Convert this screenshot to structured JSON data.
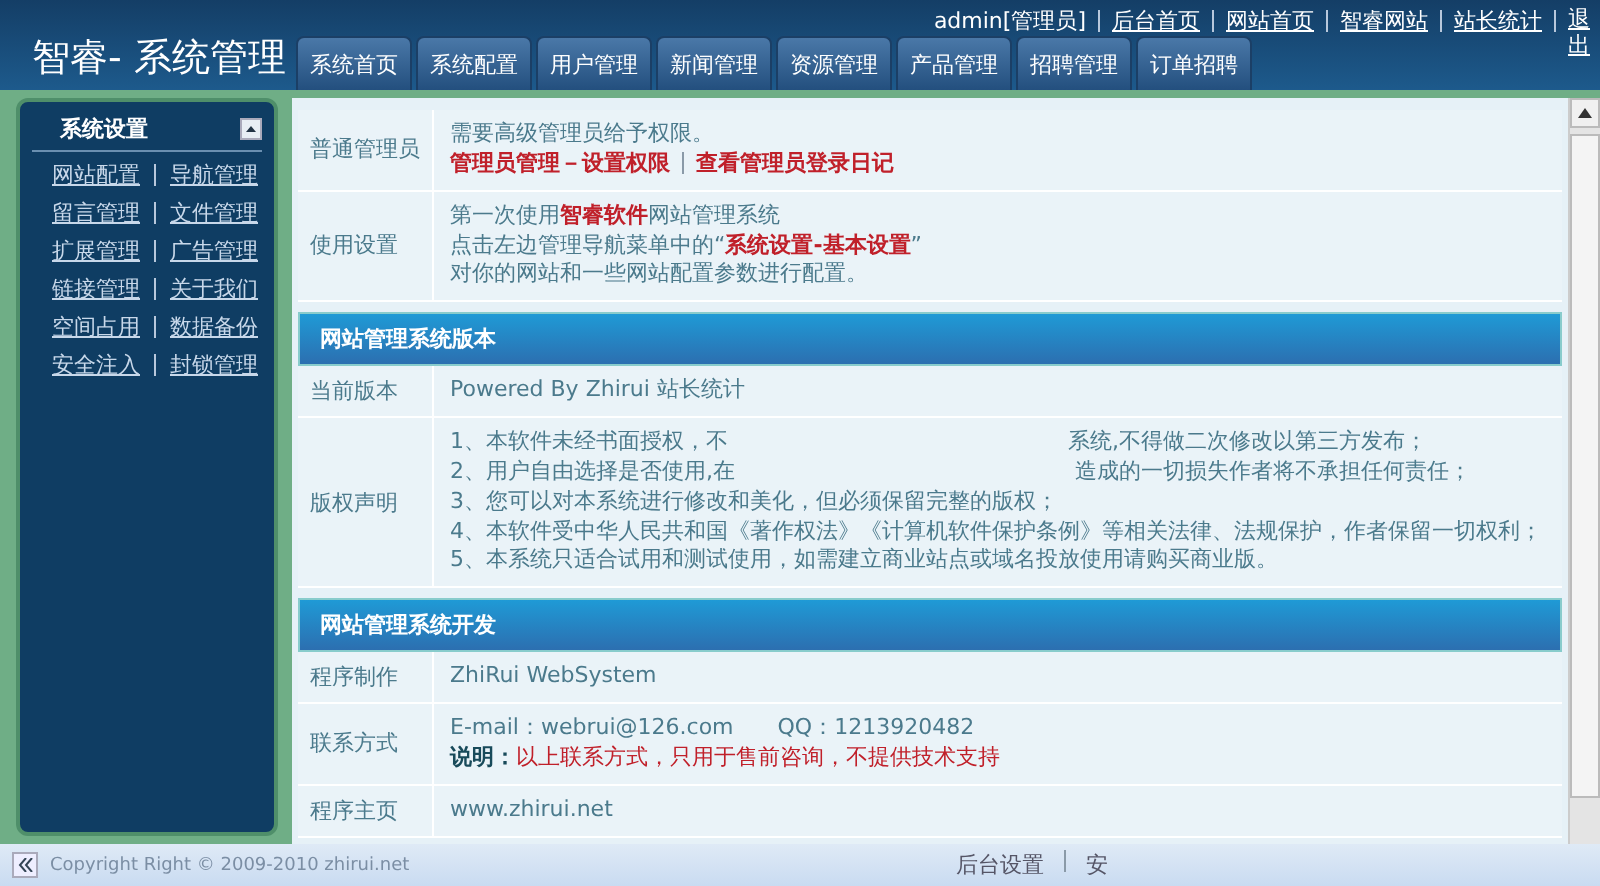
{
  "brand": "智睿- 系统管理",
  "top_links": [
    {
      "label": "admin[管理员]",
      "kind": "text"
    },
    {
      "label": "后台首页",
      "kind": "link"
    },
    {
      "label": "网站首页",
      "kind": "link"
    },
    {
      "label": "智睿网站",
      "kind": "link"
    },
    {
      "label": "站长统计",
      "kind": "link"
    },
    {
      "label": "退出",
      "kind": "link"
    }
  ],
  "tabs": [
    "系统首页",
    "系统配置",
    "用户管理",
    "新闻管理",
    "资源管理",
    "产品管理",
    "招聘管理",
    "订单招聘"
  ],
  "sidebar": {
    "title": "系统设置",
    "links": [
      "网站配置",
      "导航管理",
      "留言管理",
      "文件管理",
      "扩展管理",
      "广告管理",
      "链接管理",
      "关于我们",
      "空间占用",
      "数据备份",
      "安全注入",
      "封锁管理"
    ]
  },
  "sections": [
    {
      "rows": [
        {
          "label": "普通管理员",
          "lines": [
            {
              "kind": "plain",
              "text": "需要高级管理员给予权限。"
            },
            {
              "kind": "links",
              "items": [
                "管理员管理－设置权限",
                "查看管理员登录日记"
              ]
            }
          ]
        },
        {
          "label": "使用设置",
          "lines": [
            {
              "kind": "plain",
              "text": "第一次使用**智睿软件**网站管理系统"
            },
            {
              "kind": "plain",
              "text": "点击左边管理导航菜单中的“**系统设置-基本设置**”"
            },
            {
              "kind": "plain",
              "text": "对你的网站和一些网站配置参数进行配置。"
            }
          ]
        }
      ]
    },
    {
      "title": "网站管理系统版本",
      "rows": [
        {
          "label": "当前版本",
          "lines": [
            {
              "kind": "plain",
              "text": "Powered By Zhirui 站长统计"
            }
          ]
        },
        {
          "label": "版权声明",
          "lines": [
            {
              "kind": "gapped",
              "parts": [
                "1、本软件未经书面授权，不",
                "系统,不得做二次修改以第三方发布；"
              ]
            },
            {
              "kind": "gapped",
              "parts": [
                "2、用户自由选择是否使用,在",
                "造成的一切损失作者将不承担任何责任；"
              ]
            },
            {
              "kind": "plain",
              "text": "3、您可以对本系统进行修改和美化，但必须保留完整的版权；"
            },
            {
              "kind": "plain",
              "text": "4、本软件受中华人民共和国《著作权法》《计算机软件保护条例》等相关法律、法规保护，作者保留一切权利；"
            },
            {
              "kind": "plain",
              "text": "5、本系统只适合试用和测试使用，如需建立商业站点或域名投放使用请购买商业版。"
            }
          ]
        }
      ]
    },
    {
      "title": "网站管理系统开发",
      "rows": [
        {
          "label": "程序制作",
          "lines": [
            {
              "kind": "plain",
              "text": "ZhiRui WebSystem"
            }
          ]
        },
        {
          "label": "联系方式",
          "lines": [
            {
              "kind": "plain",
              "text": "E-mail：webrui@126.com　　QQ：1213920482"
            },
            {
              "kind": "note",
              "text": "**说明：**以上联系方式，只用于售前咨询，不提供技术支持"
            }
          ]
        },
        {
          "label": "程序主页",
          "lines": [
            {
              "kind": "plain",
              "text": "www.zhirui.net"
            }
          ]
        }
      ]
    }
  ],
  "footer": {
    "copyright": "Copyright Right © 2009-2010 zhirui.net",
    "links": [
      "后台设置",
      "安"
    ]
  }
}
